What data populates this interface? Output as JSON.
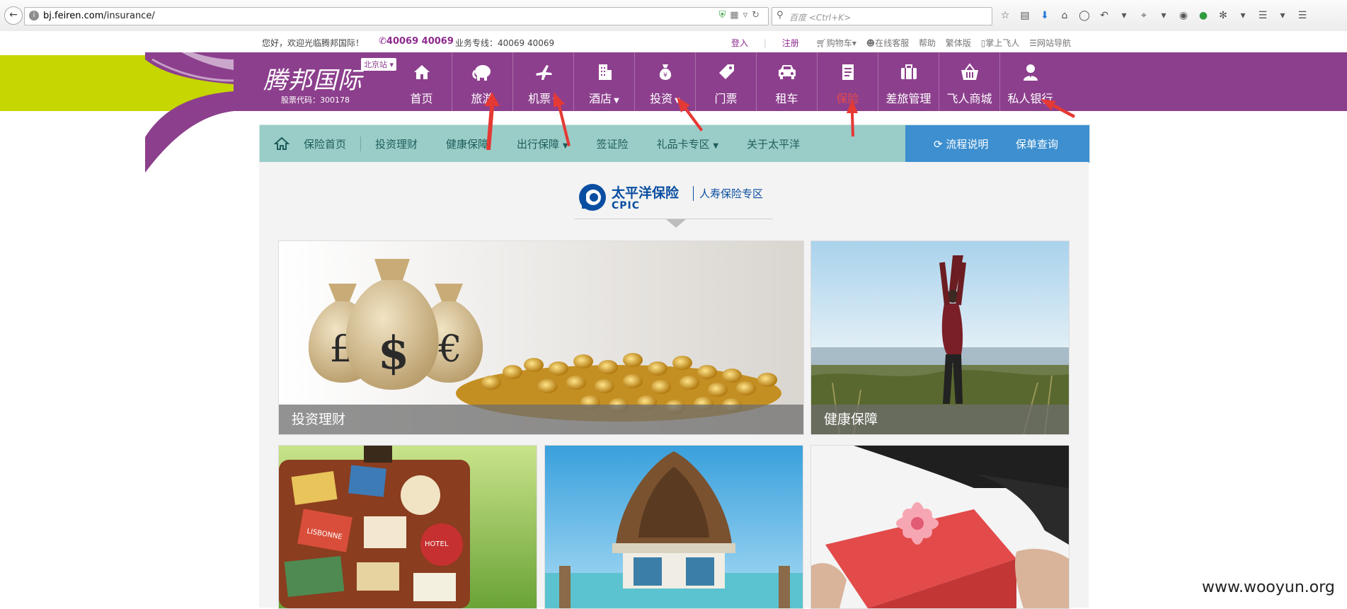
{
  "browser": {
    "back_icon": "back-arrow-icon",
    "url_host": "bj.feiren.com",
    "url_path": "/insurance/",
    "search_placeholder": "百度 <Ctrl+K>"
  },
  "topbar": {
    "welcome": "您好，欢迎光临腾邦国际！",
    "phone": "40069 40069",
    "hotline": "业务专线：40069 40069",
    "login": "登入",
    "separator": "|",
    "register": "注册",
    "links": [
      "购物车",
      "在线客服",
      "帮助",
      "繁体版",
      "掌上飞人",
      "网站导航"
    ]
  },
  "logo": {
    "name": "腾邦国际",
    "station": "北京站",
    "stock_code": "股票代码：300178"
  },
  "main_nav": [
    {
      "label": "首页",
      "icon": "home-icon",
      "caret": false
    },
    {
      "label": "旅游",
      "icon": "elephant-icon",
      "caret": false
    },
    {
      "label": "机票",
      "icon": "plane-icon",
      "caret": true
    },
    {
      "label": "酒店",
      "icon": "building-icon",
      "caret": true
    },
    {
      "label": "投资",
      "icon": "money-bag-icon",
      "caret": true
    },
    {
      "label": "门票",
      "icon": "ticket-tag-icon",
      "caret": false
    },
    {
      "label": "租车",
      "icon": "car-icon",
      "caret": false
    },
    {
      "label": "保险",
      "icon": "document-icon",
      "caret": false,
      "active": true
    },
    {
      "label": "差旅管理",
      "icon": "briefcase-icon",
      "caret": false
    },
    {
      "label": "飞人商城",
      "icon": "basket-icon",
      "caret": false
    },
    {
      "label": "私人银行",
      "icon": "person-icon",
      "caret": false
    }
  ],
  "sub_nav": {
    "home_icon": "home-icon",
    "items": [
      {
        "label": "保险首页",
        "caret": false
      },
      {
        "label": "投资理财",
        "caret": false
      },
      {
        "label": "健康保障",
        "caret": false
      },
      {
        "label": "出行保障",
        "caret": true
      },
      {
        "label": "签证险",
        "caret": false
      },
      {
        "label": "礼品卡专区",
        "caret": true
      },
      {
        "label": "关于太平洋",
        "caret": false
      }
    ],
    "flow": "流程说明",
    "query": "保单查询"
  },
  "brand_block": {
    "cn_name": "太平洋保险",
    "en_name": "CPIC",
    "subtitle": "人寿保险专区"
  },
  "tiles": [
    {
      "caption": "投资理财"
    },
    {
      "caption": "健康保障"
    },
    {
      "caption": ""
    },
    {
      "caption": ""
    },
    {
      "caption": ""
    }
  ],
  "watermark": "www.wooyun.org",
  "colors": {
    "brand_purple": "#8c3f8d",
    "lime": "#c5d600",
    "teal": "#9acdc8",
    "blue_tab": "#3d8fcf",
    "cpic_blue": "#0a4ea1",
    "annotation_red": "#e53935"
  }
}
